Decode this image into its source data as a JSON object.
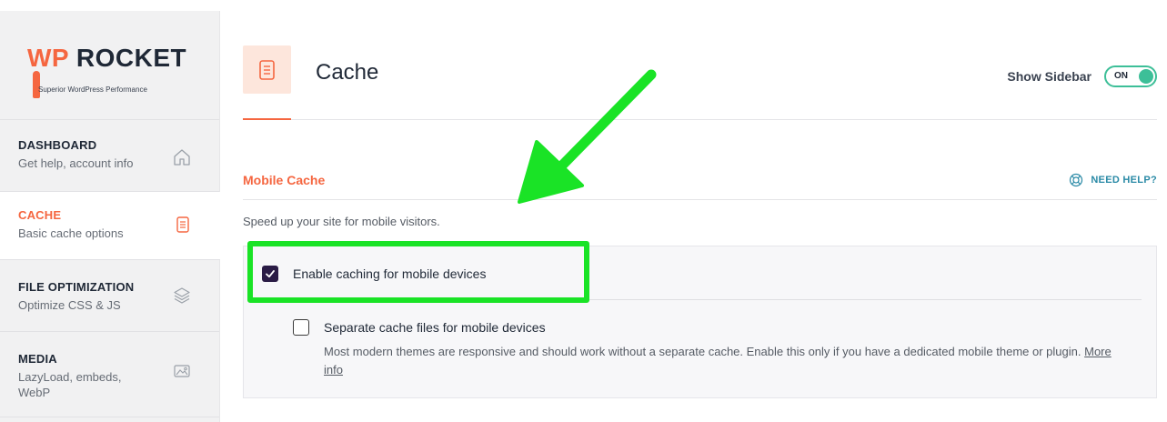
{
  "logo": {
    "brand_wp": "WP",
    "brand_rocket": " ROCKET",
    "tagline": "Superior WordPress Performance"
  },
  "sidebar": {
    "items": [
      {
        "title": "DASHBOARD",
        "subtitle": "Get help, account info",
        "icon": "home-icon",
        "active": false
      },
      {
        "title": "CACHE",
        "subtitle": "Basic cache options",
        "icon": "document-icon",
        "active": true
      },
      {
        "title": "FILE OPTIMIZATION",
        "subtitle": "Optimize CSS & JS",
        "icon": "layers-icon",
        "active": false
      },
      {
        "title": "MEDIA",
        "subtitle": "LazyLoad, embeds, WebP",
        "icon": "image-icon",
        "active": false
      }
    ]
  },
  "header": {
    "title": "Cache",
    "show_sidebar_label": "Show Sidebar",
    "toggle_state": "ON"
  },
  "section": {
    "title": "Mobile Cache",
    "help_label": "NEED HELP?",
    "description": "Speed up your site for mobile visitors."
  },
  "options": [
    {
      "label": "Enable caching for mobile devices",
      "checked": true
    },
    {
      "label": "Separate cache files for mobile devices",
      "checked": false,
      "description": "Most modern themes are responsive and should work without a separate cache. Enable this only if you have a dedicated mobile theme or plugin.",
      "link_text": "More info"
    }
  ],
  "colors": {
    "accent": "#f56640",
    "toggle": "#3dbf98",
    "checkbox_checked": "#2a1b45",
    "help": "#2a8aa6",
    "annotation": "#1ae326"
  }
}
